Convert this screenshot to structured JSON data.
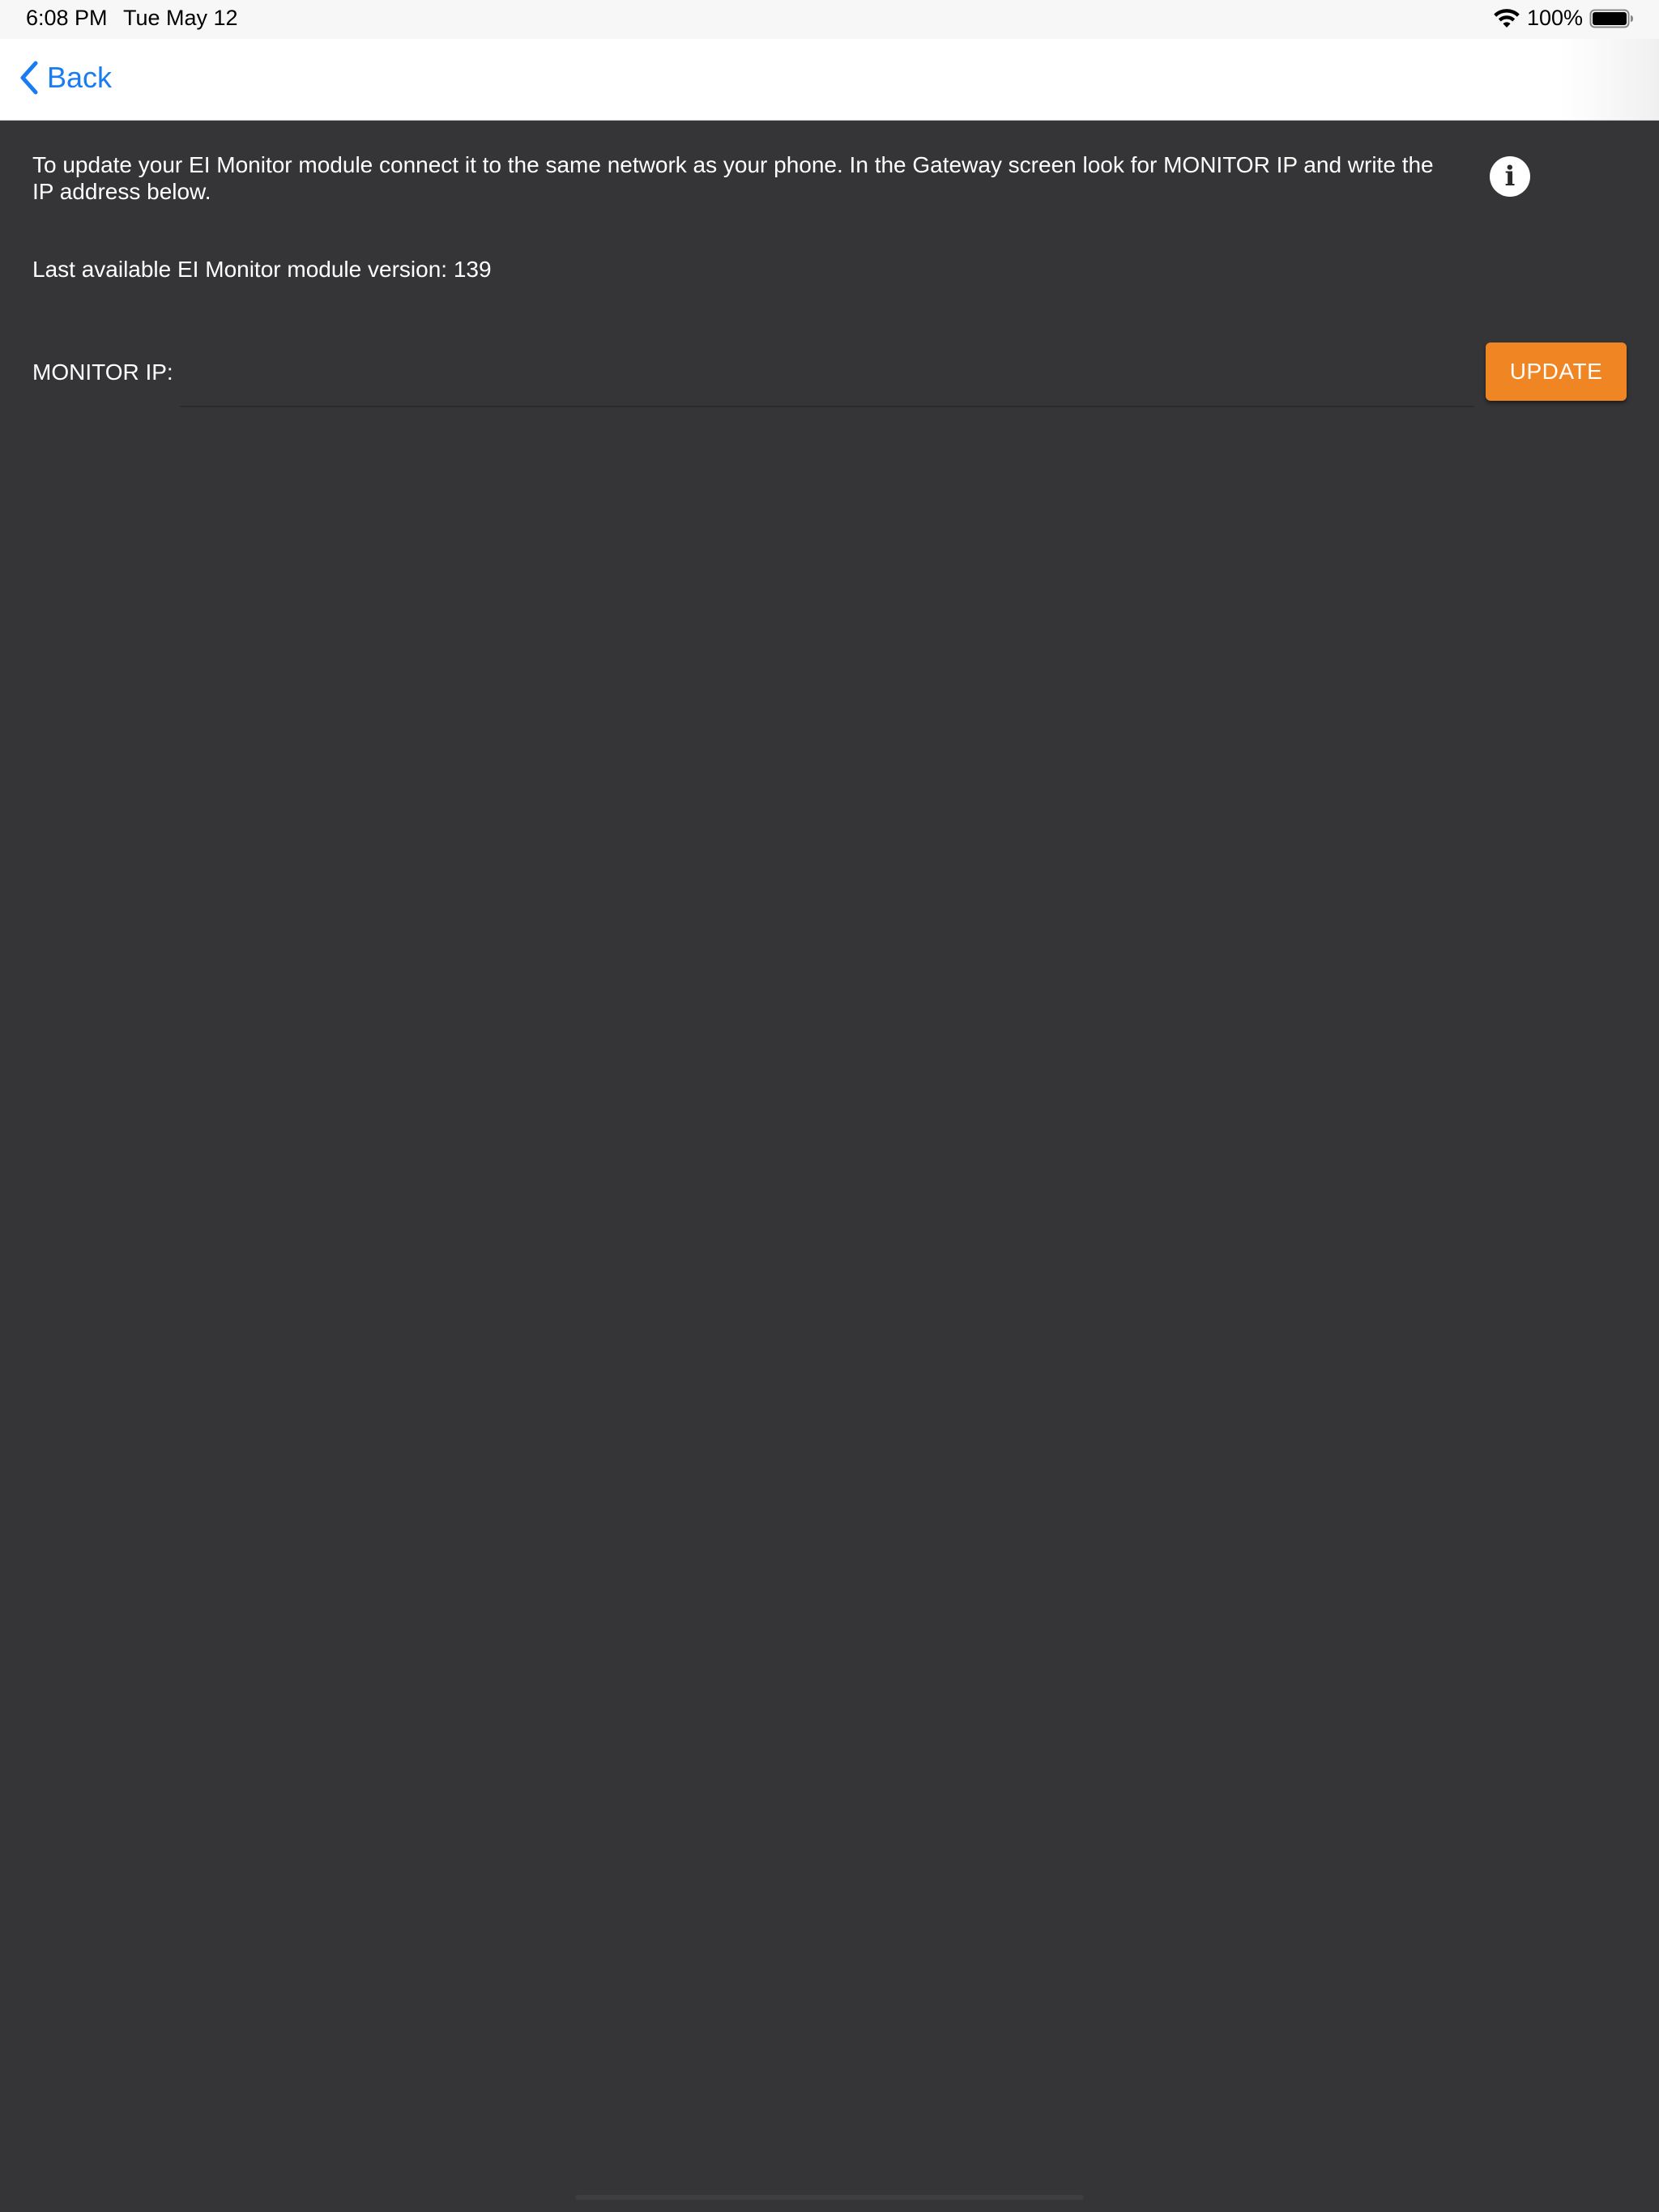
{
  "status_bar": {
    "time": "6:08 PM",
    "date": "Tue May 12",
    "battery": "100%",
    "icons": [
      "wifi-icon",
      "battery-icon"
    ]
  },
  "nav": {
    "back_label": "Back",
    "icon": "chevron-left-icon"
  },
  "main": {
    "instructions": "To update your EI Monitor module connect it to the same network as your phone. In the Gateway screen look for MONITOR IP and write the IP address below.",
    "info_icon": "info-icon",
    "version_text": "Last available EI Monitor module version: 139",
    "ip_label": "MONITOR IP:",
    "ip_value": "",
    "update_label": "UPDATE"
  },
  "colors": {
    "background": "#353537",
    "accent": "#f08524",
    "link": "#1a7cf0"
  }
}
